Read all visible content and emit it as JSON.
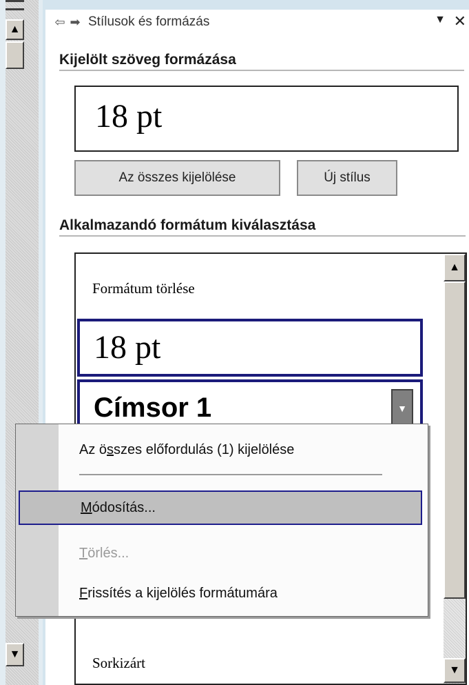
{
  "pane": {
    "title": "Stílusok és formázás",
    "icons": {
      "back": "back-arrow-icon",
      "forward": "forward-arrow-icon",
      "dropdown": "dropdown-arrow-icon",
      "close": "close-icon"
    }
  },
  "section_formatting": {
    "title": "Kijelölt szöveg formázása",
    "current_format": "18 pt",
    "select_all_label": "Az összes kijelölése",
    "new_style_label": "Új stílus"
  },
  "section_apply": {
    "title": "Alkalmazandó formátum kiválasztása",
    "items": [
      {
        "label": "Formátum törlése"
      },
      {
        "label": "18 pt",
        "selected": true
      },
      {
        "label": "Címsor 1",
        "selected": true
      },
      {
        "label": "Sorkizárt"
      }
    ]
  },
  "context_menu": {
    "items": [
      {
        "pre": "Az ö",
        "acc": "s",
        "post": "szes előfordulás (1) kijelölése",
        "enabled": true
      },
      {
        "pre": "",
        "acc": "M",
        "post": "ódosítás...",
        "enabled": true,
        "highlighted": true
      },
      {
        "pre": "",
        "acc": "T",
        "post": "örlés...",
        "enabled": false
      },
      {
        "pre": "",
        "acc": "F",
        "post": "rissítés a kijelölés formátumára",
        "enabled": true
      }
    ]
  },
  "colors": {
    "selection_border": "#1b1b7a",
    "menu_highlight": "#bfbfbf"
  }
}
